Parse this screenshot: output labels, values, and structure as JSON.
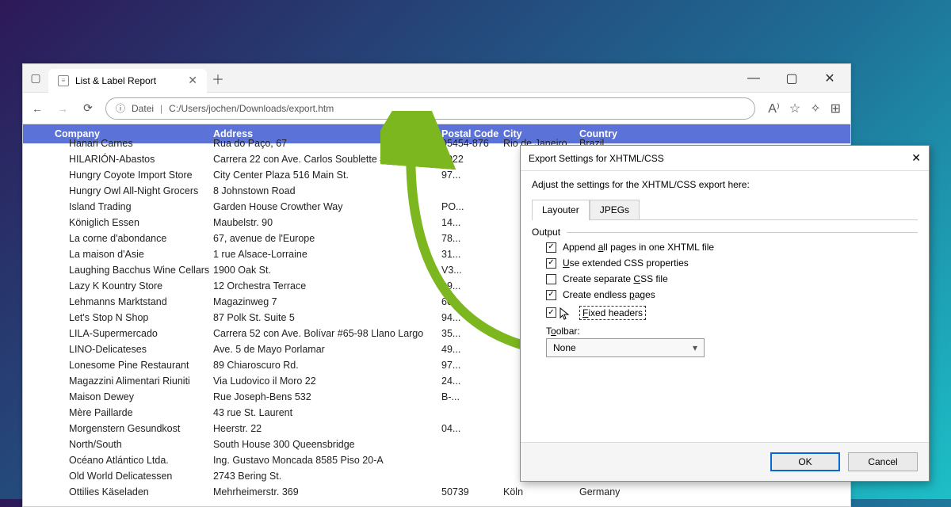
{
  "browser": {
    "tab_title": "List & Label Report",
    "url_prefix": "Datei",
    "url_path": "C:/Users/jochen/Downloads/export.htm",
    "info_icon_label": "ⓘ"
  },
  "table": {
    "headers": [
      "Company",
      "Address",
      "Postal Code",
      "City",
      "Country"
    ],
    "rows": [
      [
        "Hanari Carnes",
        "Rua do Paço, 67",
        "05454-876",
        "Rio de Janeiro",
        "Brazil"
      ],
      [
        "HILARIÓN-Abastos",
        "Carrera 22 con Ave. Carlos Soublette #8-35",
        "5022",
        "",
        ""
      ],
      [
        "Hungry Coyote Import Store",
        "City Center Plaza 516 Main St.",
        "97...",
        "",
        ""
      ],
      [
        "Hungry Owl All-Night Grocers",
        "8 Johnstown Road",
        "",
        "",
        ""
      ],
      [
        "Island Trading",
        "Garden House Crowther Way",
        "PO...",
        "",
        ""
      ],
      [
        "Königlich Essen",
        "Maubelstr. 90",
        "14...",
        "",
        ""
      ],
      [
        "La corne d'abondance",
        "67, avenue de l'Europe",
        "78...",
        "",
        ""
      ],
      [
        "La maison d'Asie",
        "1 rue Alsace-Lorraine",
        "31...",
        "",
        ""
      ],
      [
        "Laughing Bacchus Wine Cellars",
        "1900 Oak St.",
        "V3...",
        "",
        ""
      ],
      [
        "Lazy K Kountry Store",
        "12 Orchestra Terrace",
        "99...",
        "",
        ""
      ],
      [
        "Lehmanns Marktstand",
        "Magazinweg 7",
        "60...",
        "",
        ""
      ],
      [
        "Let's Stop N Shop",
        "87 Polk St. Suite 5",
        "94...",
        "",
        ""
      ],
      [
        "LILA-Supermercado",
        "Carrera 52 con Ave. Bolívar #65-98 Llano Largo",
        "35...",
        "",
        ""
      ],
      [
        "LINO-Delicateses",
        "Ave. 5 de Mayo Porlamar",
        "49...",
        "",
        ""
      ],
      [
        "Lonesome Pine Restaurant",
        "89 Chiaroscuro Rd.",
        "97...",
        "",
        ""
      ],
      [
        "Magazzini Alimentari Riuniti",
        "Via Ludovico il Moro 22",
        "24...",
        "",
        ""
      ],
      [
        "Maison Dewey",
        "Rue Joseph-Bens 532",
        "B-...",
        "",
        ""
      ],
      [
        "Mère Paillarde",
        "43 rue St. Laurent",
        "",
        "",
        ""
      ],
      [
        "Morgenstern Gesundkost",
        "Heerstr. 22",
        "04...",
        "",
        ""
      ],
      [
        "North/South",
        "South House 300 Queensbridge",
        "",
        "",
        ""
      ],
      [
        "Océano Atlántico Ltda.",
        "Ing. Gustavo Moncada 8585 Piso 20-A",
        "",
        "",
        ""
      ],
      [
        "Old World Delicatessen",
        "2743 Bering St.",
        "",
        "",
        ""
      ],
      [
        "Ottilies Käseladen",
        "Mehrheimerstr. 369",
        "50739",
        "Köln",
        "Germany"
      ]
    ]
  },
  "dialog": {
    "title": "Export Settings for XHTML/CSS",
    "hint": "Adjust the settings for the XHTML/CSS export here:",
    "tab_layouter": "Layouter",
    "tab_jpegs": "JPEGs",
    "section_output": "Output",
    "opt_append": "Append all pages in one XHTML file",
    "opt_css_ext": "Use extended CSS properties",
    "opt_sep_css": "Create separate CSS file",
    "opt_endless": "Create endless pages",
    "opt_fixed": "Fixed headers",
    "toolbar_label": "Toolbar:",
    "toolbar_value": "None",
    "btn_ok": "OK",
    "btn_cancel": "Cancel"
  }
}
